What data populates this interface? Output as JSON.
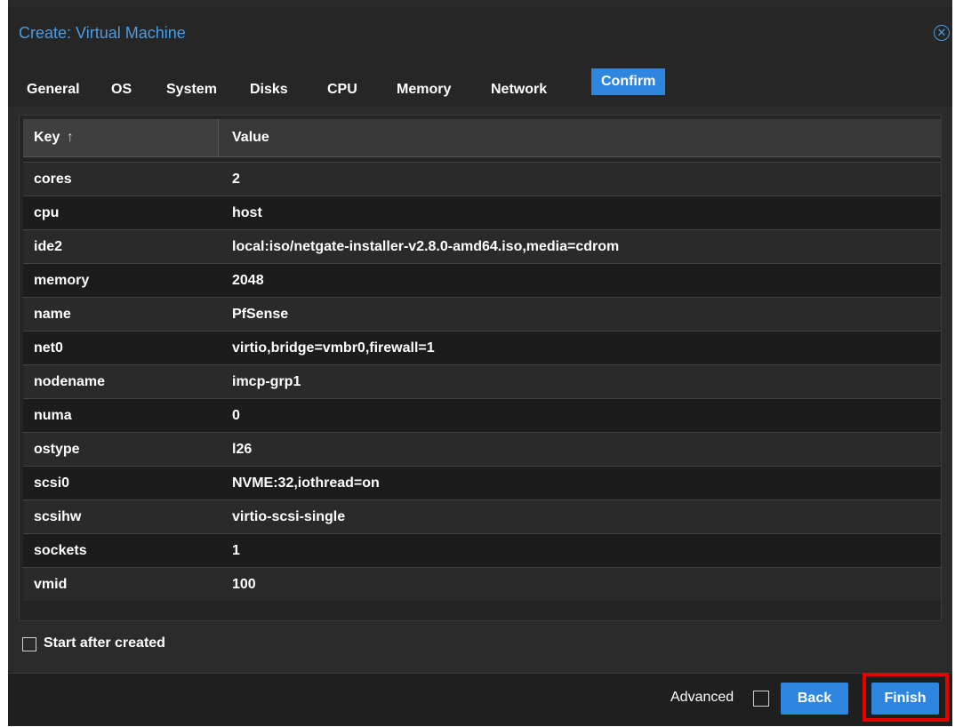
{
  "dialog": {
    "title": "Create: Virtual Machine",
    "close_icon": "close-circle-icon"
  },
  "tabs": [
    {
      "label": "General"
    },
    {
      "label": "OS"
    },
    {
      "label": "System"
    },
    {
      "label": "Disks"
    },
    {
      "label": "CPU"
    },
    {
      "label": "Memory"
    },
    {
      "label": "Network"
    },
    {
      "label": "Confirm",
      "active": true
    }
  ],
  "grid": {
    "header_key": "Key",
    "sort_icon": "↑",
    "header_value": "Value",
    "rows": [
      {
        "key": "cores",
        "value": "2"
      },
      {
        "key": "cpu",
        "value": "host"
      },
      {
        "key": "ide2",
        "value": "local:iso/netgate-installer-v2.8.0-amd64.iso,media=cdrom"
      },
      {
        "key": "memory",
        "value": "2048"
      },
      {
        "key": "name",
        "value": "PfSense"
      },
      {
        "key": "net0",
        "value": "virtio,bridge=vmbr0,firewall=1"
      },
      {
        "key": "nodename",
        "value": "imcp-grp1"
      },
      {
        "key": "numa",
        "value": "0"
      },
      {
        "key": "ostype",
        "value": "l26"
      },
      {
        "key": "scsi0",
        "value": "NVME:32,iothread=on"
      },
      {
        "key": "scsihw",
        "value": "virtio-scsi-single"
      },
      {
        "key": "sockets",
        "value": "1"
      },
      {
        "key": "vmid",
        "value": "100"
      }
    ]
  },
  "options": {
    "start_after_created_label": "Start after created",
    "start_after_created_checked": false
  },
  "footer": {
    "advanced_label": "Advanced",
    "advanced_checked": false,
    "back_label": "Back",
    "finish_label": "Finish"
  },
  "colors": {
    "accent": "#2e86de",
    "title": "#4a9ce0",
    "highlight": "#e60000",
    "background": "#2b2b2b"
  }
}
